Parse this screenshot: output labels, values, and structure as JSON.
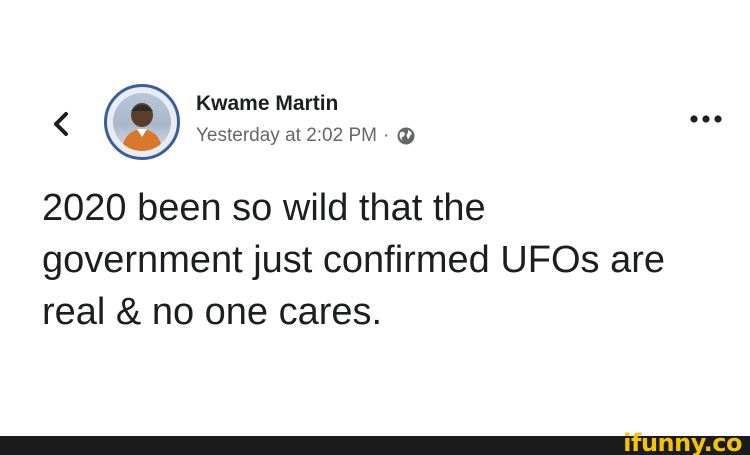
{
  "post": {
    "author": "Kwame Martin",
    "timestamp": "Yesterday at 2:02 PM",
    "separator": "·",
    "privacy_icon": "globe-icon",
    "lines": [
      "2020 been so wild that the",
      "government just confirmed UFOs are",
      "real & no one cares."
    ]
  },
  "header": {
    "back_icon": "chevron-left-icon",
    "more_icon": "more-dots-icon"
  },
  "watermark": {
    "text": "ifunny.co"
  },
  "colors": {
    "text_primary": "#1c1e21",
    "text_secondary": "#65676b",
    "watermark_bar": "#1b1b1d",
    "watermark_text": "#f5c400"
  }
}
